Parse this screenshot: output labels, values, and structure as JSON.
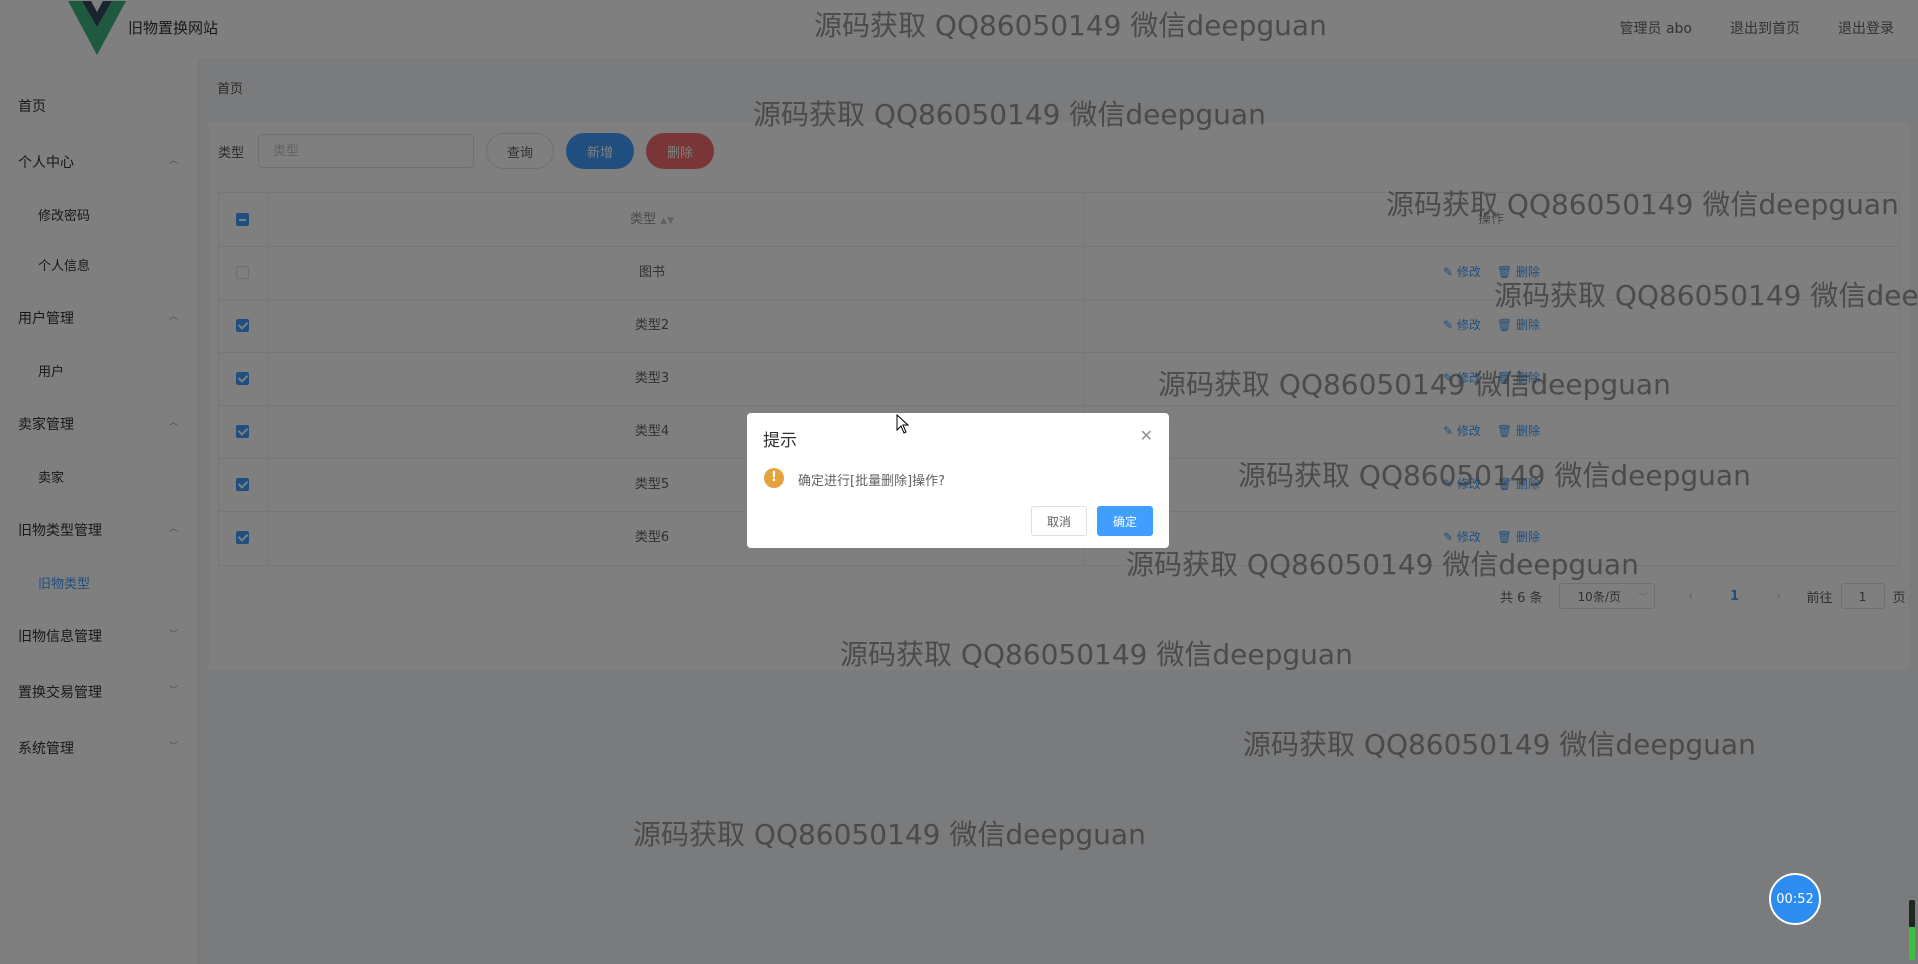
{
  "header": {
    "site_title": "旧物置换网站",
    "links": [
      "管理员 abo",
      "退出到首页",
      "退出登录"
    ]
  },
  "sidebar": {
    "items": [
      {
        "label": "首页",
        "type": "top"
      },
      {
        "label": "个人中心",
        "type": "group",
        "expanded": true
      },
      {
        "label": "修改密码",
        "type": "sub"
      },
      {
        "label": "个人信息",
        "type": "sub"
      },
      {
        "label": "用户管理",
        "type": "group",
        "expanded": true
      },
      {
        "label": "用户",
        "type": "sub"
      },
      {
        "label": "卖家管理",
        "type": "group",
        "expanded": true
      },
      {
        "label": "卖家",
        "type": "sub"
      },
      {
        "label": "旧物类型管理",
        "type": "group",
        "expanded": true
      },
      {
        "label": "旧物类型",
        "type": "sub",
        "active": true
      },
      {
        "label": "旧物信息管理",
        "type": "group",
        "expanded": false
      },
      {
        "label": "置换交易管理",
        "type": "group",
        "expanded": false
      },
      {
        "label": "系统管理",
        "type": "group",
        "expanded": false
      }
    ]
  },
  "breadcrumb": "首页",
  "search": {
    "label": "类型",
    "placeholder": "类型",
    "query_label": "查询",
    "add_label": "新增",
    "delete_label": "删除"
  },
  "table": {
    "headers": [
      "类型",
      "操作"
    ],
    "edit_label": "修改",
    "delete_label": "删除",
    "rows": [
      {
        "type": "图书",
        "checked": false
      },
      {
        "type": "类型2",
        "checked": true
      },
      {
        "type": "类型3",
        "checked": true
      },
      {
        "type": "类型4",
        "checked": true
      },
      {
        "type": "类型5",
        "checked": true
      },
      {
        "type": "类型6",
        "checked": true
      }
    ]
  },
  "pagination": {
    "total": "共 6 条",
    "page_size": "10条/页",
    "current_page": "1",
    "goto_label": "前往",
    "goto_value": "1",
    "page_unit": "页"
  },
  "dialog": {
    "title": "提示",
    "message": "确定进行[批量删除]操作?",
    "cancel_label": "取消",
    "ok_label": "确定"
  },
  "watermark": "源码获取 QQ86050149 微信deepguan",
  "timer": "00:52",
  "audio_level": 0.55,
  "colors": {
    "primary": "#409EFF",
    "danger": "#F56C6C",
    "warning": "#E6A23C"
  }
}
